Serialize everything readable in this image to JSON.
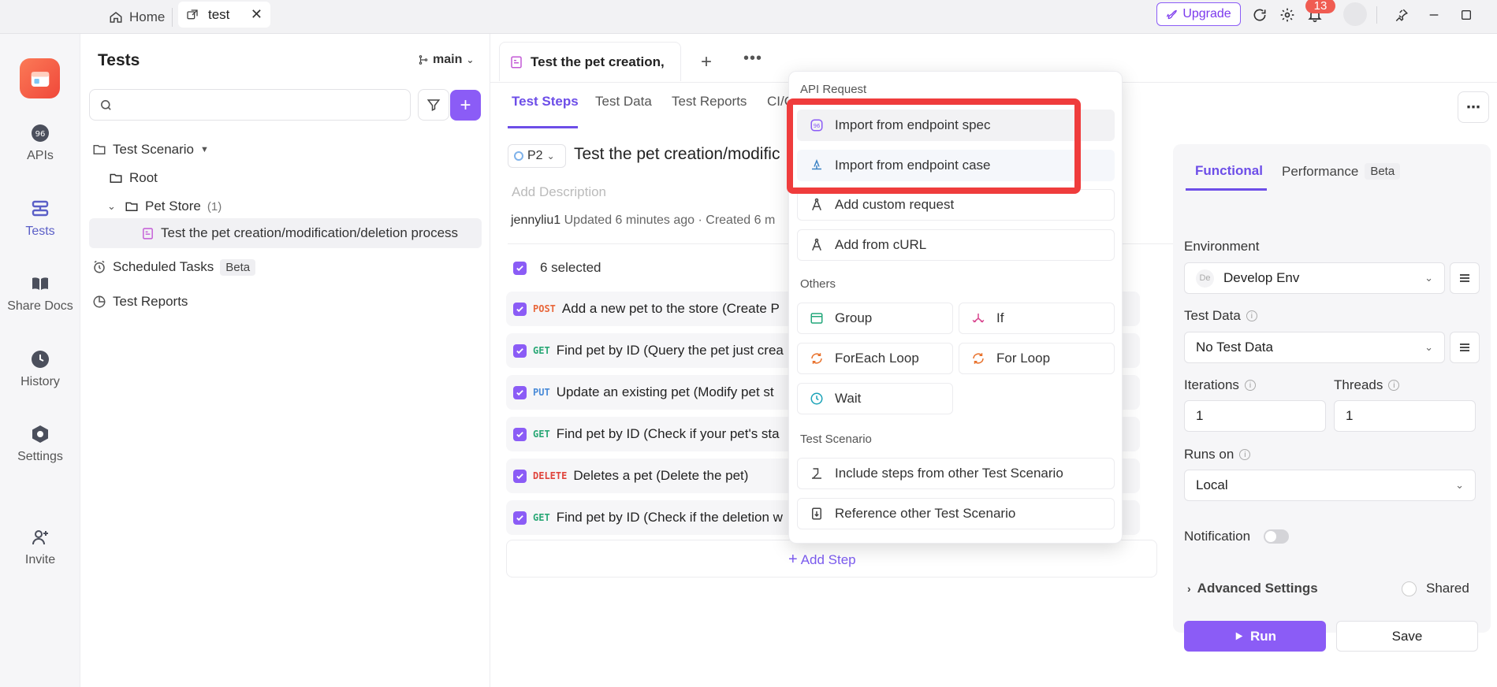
{
  "topbar": {
    "home_label": "Home",
    "tab_label": "test",
    "upgrade_label": "Upgrade",
    "notifications_count": "13"
  },
  "rail": {
    "items": [
      {
        "label": "APIs"
      },
      {
        "label": "Tests"
      },
      {
        "label": "Share Docs"
      },
      {
        "label": "History"
      },
      {
        "label": "Settings"
      },
      {
        "label": "Invite"
      }
    ]
  },
  "tree": {
    "title": "Tests",
    "branch": "main",
    "search_placeholder": "",
    "test_scenario": "Test Scenario",
    "root": "Root",
    "folder": "Pet Store",
    "folder_count": "(1)",
    "scenario": "Test the pet creation/modification/deletion process",
    "scheduled_tasks": "Scheduled Tasks",
    "beta": "Beta",
    "test_reports": "Test Reports"
  },
  "main": {
    "doc_tab": "Test the pet creation,",
    "subtabs": [
      "Test Steps",
      "Test Data",
      "Test Reports",
      "CI/C"
    ],
    "priority": "P2",
    "title": "Test the pet creation/modific",
    "add_description": "Add Description",
    "author": "jennyliu1",
    "meta": "Updated 6 minutes ago · Created 6 m",
    "selected": "6 selected",
    "steps": [
      {
        "method": "POST",
        "color": "#e8663a",
        "text": "Add a new pet to the store (Create P"
      },
      {
        "method": "GET",
        "color": "#2aa876",
        "text": "Find pet by ID (Query the pet just crea"
      },
      {
        "method": "PUT",
        "color": "#4a8bd8",
        "text": "Update an existing pet (Modify pet st"
      },
      {
        "method": "GET",
        "color": "#2aa876",
        "text": "Find pet by ID (Check if your pet's sta"
      },
      {
        "method": "DELETE",
        "color": "#e0443c",
        "text": "Deletes a pet (Delete the pet)"
      },
      {
        "method": "GET",
        "color": "#2aa876",
        "text": "Find pet by ID (Check if the deletion w"
      }
    ],
    "add_step": "Add Step"
  },
  "config": {
    "tab_functional": "Functional",
    "tab_performance": "Performance",
    "beta": "Beta",
    "environment_label": "Environment",
    "environment_badge": "De",
    "environment_value": "Develop Env",
    "test_data_label": "Test Data",
    "test_data_value": "No Test Data",
    "iterations_label": "Iterations",
    "iterations_value": "1",
    "threads_label": "Threads",
    "threads_value": "1",
    "runs_on_label": "Runs on",
    "runs_on_value": "Local",
    "notification_label": "Notification",
    "notification_on": false,
    "advanced_settings": "Advanced Settings",
    "shared": "Shared",
    "run": "Run",
    "save": "Save"
  },
  "dropdown": {
    "api_request_header": "API Request",
    "import_spec": "Import from endpoint spec",
    "import_case": "Import from endpoint case",
    "add_custom": "Add custom request",
    "add_curl": "Add from cURL",
    "others_header": "Others",
    "group": "Group",
    "if": "If",
    "foreach": "ForEach Loop",
    "for_loop": "For Loop",
    "wait": "Wait",
    "scenario_header": "Test Scenario",
    "include_steps": "Include steps from other Test Scenario",
    "reference": "Reference other Test Scenario"
  },
  "colors": {
    "accent": "#8b5cf6",
    "highlight_box": "#ef3c3c"
  }
}
